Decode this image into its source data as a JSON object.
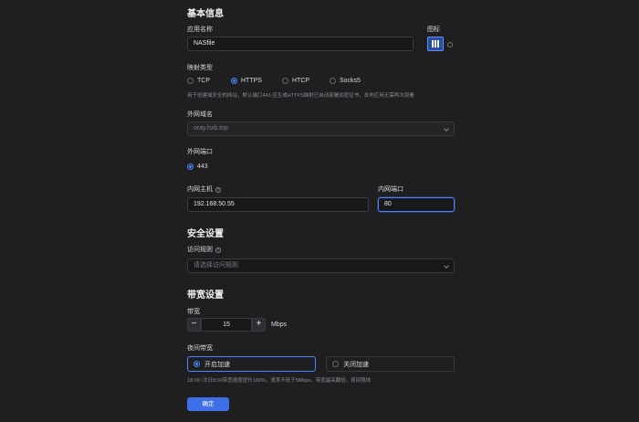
{
  "basic": {
    "title": "基本信息",
    "app_name_label": "应用名称",
    "app_name_value": "NASfile",
    "icon_label": "图标"
  },
  "mapping": {
    "type_label": "映射类型",
    "options": [
      "TCP",
      "HTTPS",
      "HTCP",
      "Socks5"
    ],
    "selected": "HTTPS",
    "hint": "用于创建域安全的网站，默认端口443 应生成HTTPS映射已自动部署加密证书，本地应用无需再次部署"
  },
  "domain": {
    "label": "外网域名",
    "value": "oray.hxb.top"
  },
  "ext_port": {
    "label": "外网端口",
    "value": "443"
  },
  "internal": {
    "host_label": "内网主机",
    "host_value": "192.168.50.55",
    "port_label": "内网端口",
    "port_value": "80"
  },
  "security": {
    "title": "安全设置",
    "rule_label": "访问规则",
    "rule_placeholder": "请选择访问规则"
  },
  "bandwidth": {
    "title": "带宽设置",
    "label": "带宽",
    "value": "15",
    "minus": "−",
    "plus": "+",
    "unit": "Mbps",
    "night_label": "夜间带宽",
    "night_on": "开启加速",
    "night_off": "关闭加速",
    "night_hint": "18:00~次日8:00带宽速度提升100%，速率不低于5Mbps，带宽最高翻倍，夜间限体"
  },
  "submit_label": "确定"
}
